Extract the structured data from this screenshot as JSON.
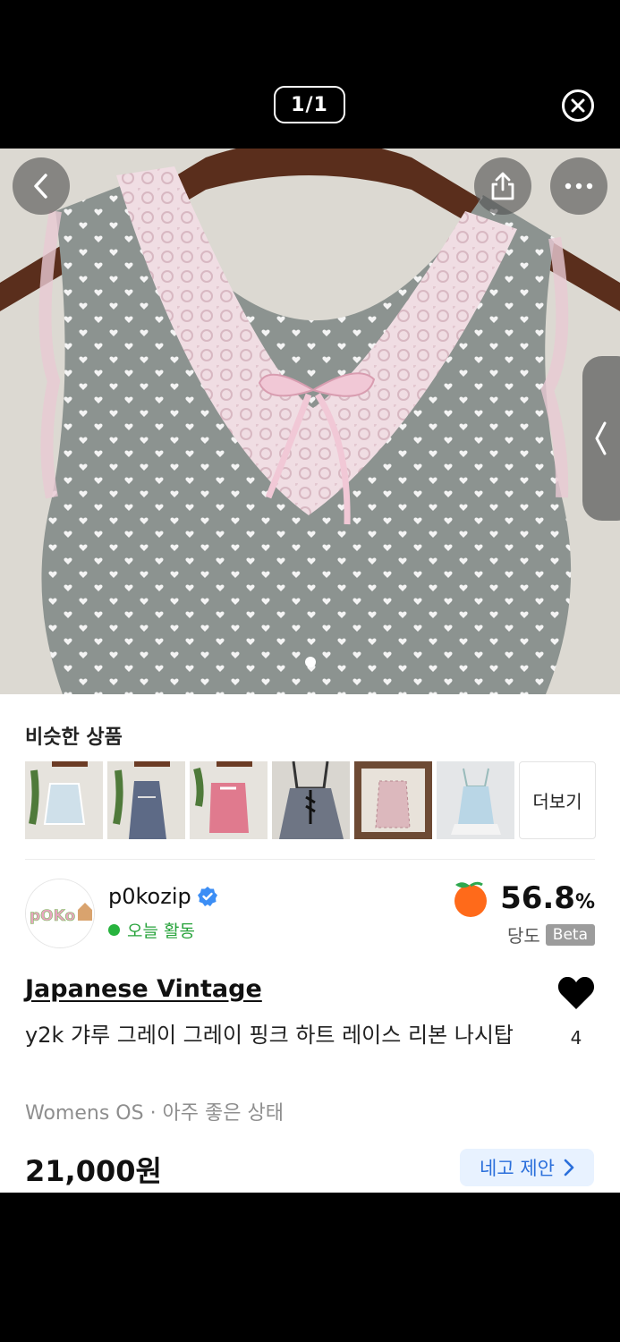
{
  "viewer": {
    "counter": "1/1",
    "close_icon": "close-circle-icon"
  },
  "photo": {
    "back_icon": "chevron-left-icon",
    "share_icon": "share-icon",
    "more_icon": "more-dots-icon",
    "side_tab_icon": "chevron-left-icon",
    "carousel": {
      "count": 1,
      "active": 1
    }
  },
  "similar": {
    "title": "비슷한 상품",
    "more_label": "더보기"
  },
  "seller": {
    "name": "p0kozip",
    "status": "오늘 활동",
    "avatar_text": "pOKo",
    "score_value": "56.8",
    "score_unit": "%",
    "score_label": "당도",
    "beta": "Beta"
  },
  "product": {
    "brand": "Japanese Vintage",
    "title": "y2k 갸루 그레이 그레이 핑크 하트 레이스 리본 나시탑",
    "meta": "Womens OS · 아주 좋은 상태",
    "price": "21,000원",
    "offer_label": "네고 제안",
    "likes": "4"
  },
  "colors": {
    "accent_blue": "#2a6fdb",
    "active_green": "#27b33e",
    "score_orange": "#ff6a1a"
  }
}
